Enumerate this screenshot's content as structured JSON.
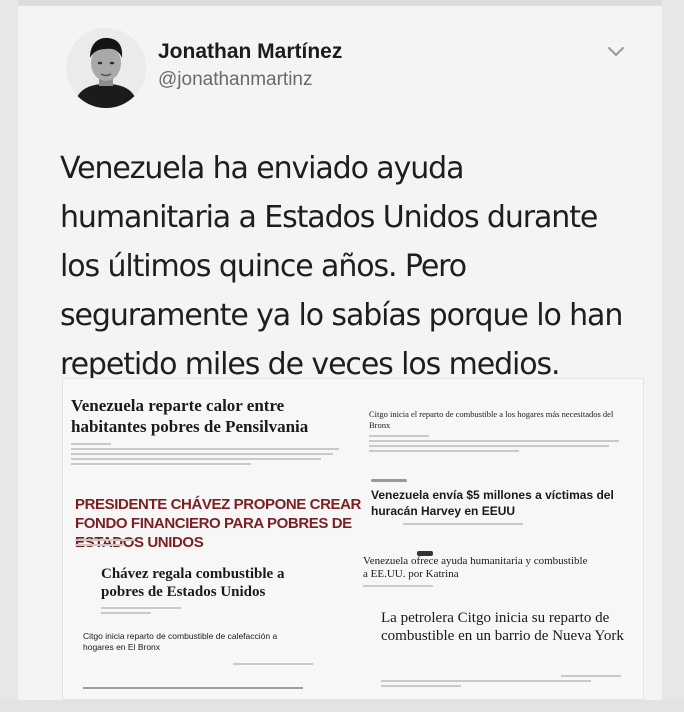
{
  "tweet": {
    "display_name": "Jonathan Martínez",
    "handle": "@jonathanmartinz",
    "text_lines": [
      "Venezuela ha enviado ayuda",
      "humanitaria a Estados Unidos durante",
      "los últimos quince años. Pero",
      "seguramente ya lo sabías porque lo han",
      "repetido miles de veces los medios."
    ]
  },
  "headlines": {
    "h1": "Venezuela reparte calor entre habitantes pobres de Pensilvania",
    "h2": "Citgo inicia el reparto de combustible a los hogares más necesitados del Bronx",
    "h3": "PRESIDENTE CHÁVEZ PROPONE CREAR FONDO FINANCIERO PARA POBRES DE ESTADOS UNIDOS",
    "h4": "Venezuela envía $5 millones a víctimas del huracán Harvey en EEUU",
    "h5": "Chávez regala combustible a pobres de Estados Unidos",
    "h6": "Venezuela ofrece ayuda humanitaria y combustible a EE.UU. por Katrina",
    "h7": "Citgo inicia reparto de combustible de calefacción a hogares en El Bronx",
    "h8": "La petrolera Citgo inicia su reparto de combustible en un barrio de Nueva York"
  },
  "icons": {
    "chevron": "chevron-down-icon",
    "avatar": "user-avatar"
  },
  "colors": {
    "text": "#1e1e1e",
    "handle": "#6a6a6a",
    "headline_red": "#7b1f23"
  }
}
